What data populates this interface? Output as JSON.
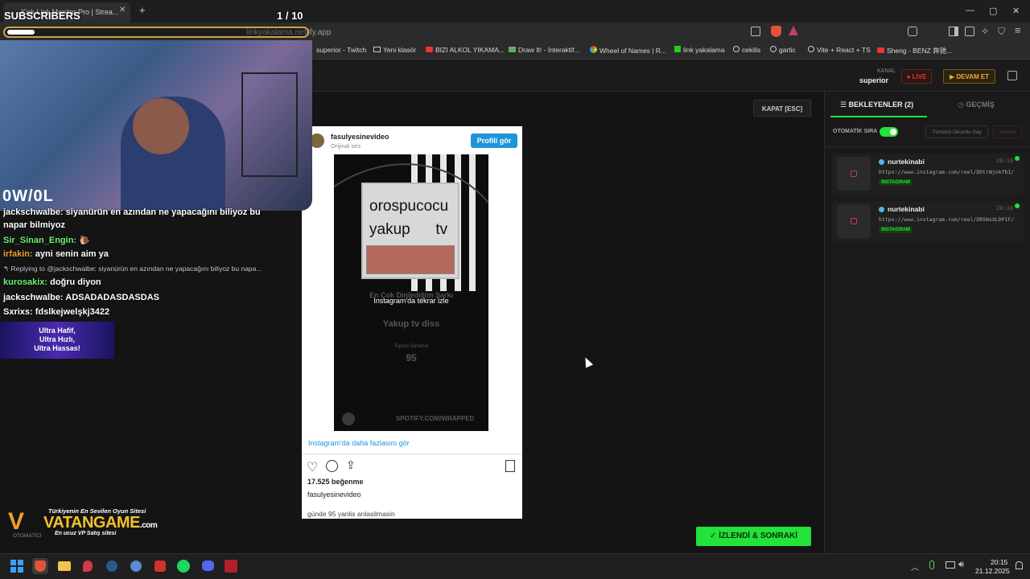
{
  "browser": {
    "tab_title": "Kick Link Monitor Pro | Strea...",
    "new_tab": "+",
    "url": "linkyakalama.netlify.app",
    "window_controls": [
      "—",
      "▢",
      "✕"
    ],
    "bookmarks": [
      {
        "label": "superior - Twitch",
        "icon": "twitch-icon"
      },
      {
        "label": "Yeni klasör",
        "icon": "folder-icon"
      },
      {
        "label": "BIZI ALKOL YIKAMA...",
        "icon": "youtube-icon"
      },
      {
        "label": "Draw It! - İnteraktif...",
        "icon": "draw-icon"
      },
      {
        "label": "Wheel of Names | R...",
        "icon": "wheel-icon"
      },
      {
        "label": "link yakalama",
        "icon": "kick-icon"
      },
      {
        "label": "cekilis",
        "icon": "globe-icon"
      },
      {
        "label": "gartic",
        "icon": "globe-icon"
      },
      {
        "label": "Vite + React + TS",
        "icon": "globe-icon"
      },
      {
        "label": "Sheng - BENZ 奔驰...",
        "icon": "youtube-icon"
      }
    ]
  },
  "overlay": {
    "subscribers_label": "SUBSCRIBERS",
    "counter": "1 / 10",
    "owl_logo": "0W/0L",
    "chat": [
      {
        "user": "jackschwalbe:",
        "text": "siyanürün en azından ne yapacağını biliyoz bu",
        "color": "#ffffff"
      },
      {
        "user": "",
        "text": "napar bilmiyoz",
        "color": "#ffffff"
      },
      {
        "user": "Sir_Sinan_Engin:",
        "text": "🐌",
        "color": "#6df26d"
      },
      {
        "user": "irfakin:",
        "text": "ayni senin aim ya",
        "color": "#f0a030"
      },
      {
        "user": "",
        "text": "↰ Replying to @jackschwalbe: siyanürün en azından ne yapacağını biliyoz bu napa...",
        "color": "#cccccc"
      },
      {
        "user": "kurosakix:",
        "text": "doğru diyon",
        "color": "#6df26d"
      },
      {
        "user": "jackschwalbe:",
        "text": "ADSADADASDASDAS",
        "color": "#ffffff"
      },
      {
        "user": "Sxrixs:",
        "text": "fdslkejwelşkj3422",
        "color": "#ffffff"
      }
    ],
    "ad_banner": [
      "Ultra Hafif,",
      "Ultra Hızlı,",
      "Ultra Hassas!"
    ],
    "vatan_tagline": "Türkiyenin En Sevilen Oyun Sitesi",
    "vatan_logo": "VATANGAME",
    "vatan_domain": ".com",
    "vatan_sub": "En ucuz VP Satış sitesi",
    "otomatik_partial": "OTOMATİCİ"
  },
  "header": {
    "kanal_label": "KANAL",
    "kanal_value": "superior",
    "live_button": "LIVE",
    "devam_button": "DEVAM ET"
  },
  "player": {
    "close_button": "KAPAT [ESC]",
    "next_button": "İZLENDİ & SONRAKİ"
  },
  "instagram": {
    "username": "fasulyesinevideo",
    "audio": "Orijinal ses",
    "profile_button": "Profili gör",
    "video_text_top": "orospucocu",
    "video_text_mid": "yakup      tv",
    "video_overlay": "Instagram'da tekrar izle",
    "wrapped_line": "En Çok Dinlediğim Şarkı",
    "song": "Yakup tv diss",
    "total_label": "Toplam Dinleme",
    "total_value": "95",
    "spotify_url": "SPOTIFY.COM/WRAPPED",
    "more_link": "Instagram'da daha fazlasını gör",
    "likes": "17.525 beğenme",
    "caption_user": "fasulyesinevideo",
    "caption": "günde 95 yanlis anlasilmasin"
  },
  "queue": {
    "tab_waiting": "BEKLEYENLER (2)",
    "tab_history": "GEÇMİŞ",
    "auto_label": "OTOMATİK SIRA",
    "auto_on": true,
    "mark_all_button": "Tümünü Okundu Say",
    "clear_button": "Temizle",
    "items": [
      {
        "user": "nurtekinabi",
        "time": "20:10",
        "url": "https://www.instagram.com/reel/DOtrWjnkfbI/",
        "platform": "INSTAGRAM"
      },
      {
        "user": "nurtekinabi",
        "time": "20:10",
        "url": "https://www.instagram.com/reel/DR5WsXLDPIF/",
        "platform": "INSTAGRAM"
      }
    ]
  },
  "taskbar": {
    "time": "20:15",
    "date": "21.12.2025"
  },
  "colors": {
    "accent_green": "#22e33a",
    "live_red": "#e0352b",
    "devam_orange": "#f0a830",
    "instagram_blue": "#1e95d8"
  }
}
